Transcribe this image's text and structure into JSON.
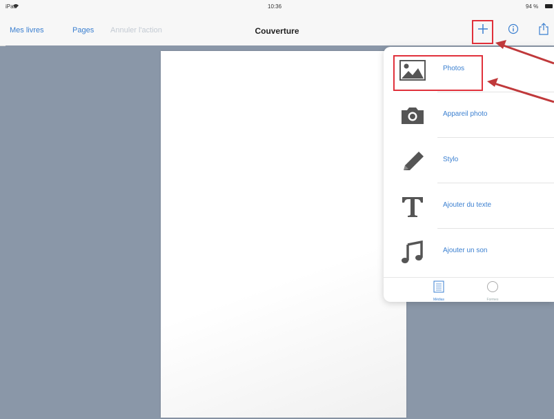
{
  "status": {
    "device": "iPad",
    "time": "10:36",
    "battery": "94 %"
  },
  "nav": {
    "my_books": "Mes livres",
    "pages": "Pages",
    "undo": "Annuler l'action",
    "title": "Couverture"
  },
  "toolbar": {
    "add_icon": "plus-icon",
    "info_icon": "info-icon",
    "share_icon": "share-icon"
  },
  "menu": {
    "items": [
      {
        "label": "Photos",
        "icon": "photos-icon"
      },
      {
        "label": "Appareil photo",
        "icon": "camera-icon"
      },
      {
        "label": "Stylo",
        "icon": "pen-icon"
      },
      {
        "label": "Ajouter du texte",
        "icon": "text-icon"
      },
      {
        "label": "Ajouter un son",
        "icon": "music-note-icon"
      }
    ],
    "tabs": [
      {
        "label": "Médias"
      },
      {
        "label": "Formes"
      }
    ]
  },
  "colors": {
    "accent": "#3a7fd0",
    "canvas": "#8a97a8",
    "annotation": "#e0303a"
  }
}
